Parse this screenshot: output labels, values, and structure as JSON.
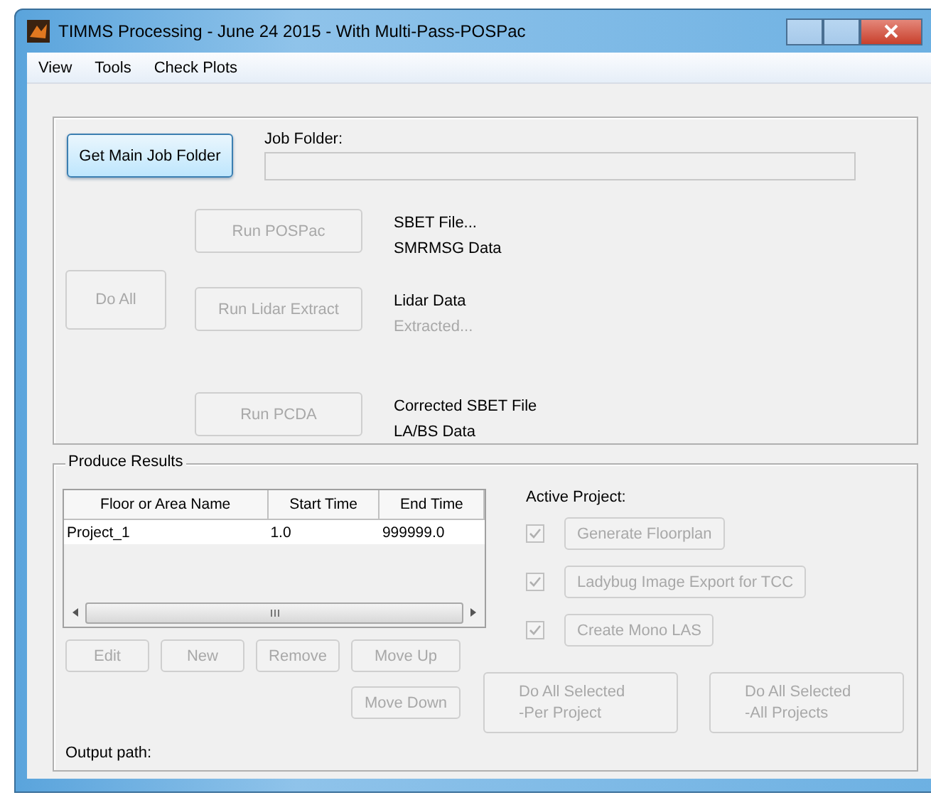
{
  "window": {
    "title": "TIMMS Processing - June 24 2015 - With Multi-Pass-POSPac"
  },
  "menu": [
    {
      "label": "View"
    },
    {
      "label": "Tools"
    },
    {
      "label": "Check Plots"
    }
  ],
  "processing": {
    "job_button": {
      "label": "Get Main Job Folder",
      "disabled": false
    },
    "job_folder_label": "Job Folder:",
    "do_all": {
      "label": "Do All",
      "disabled": true
    },
    "steps": [
      {
        "button": "Run POSPac",
        "disabled": true,
        "outputs": [
          {
            "text": "SBET File...",
            "disabled": false
          },
          {
            "text": "SMRMSG Data",
            "disabled": false
          }
        ]
      },
      {
        "button": "Run Lidar Extract",
        "disabled": true,
        "outputs": [
          {
            "text": "Lidar Data",
            "disabled": false
          },
          {
            "text": "Extracted...",
            "disabled": true
          }
        ]
      },
      {
        "button": "Run PCDA",
        "disabled": true,
        "outputs": [
          {
            "text": "Corrected SBET File",
            "disabled": false
          },
          {
            "text": "LA/BS Data",
            "disabled": false
          }
        ]
      }
    ]
  },
  "results": {
    "title": "Produce Results",
    "table": {
      "columns": [
        "Floor or Area Name",
        "Start Time",
        "End Time"
      ],
      "rows": [
        [
          "Project_1",
          "1.0",
          "999999.0"
        ]
      ]
    },
    "buttons": [
      {
        "label": "Edit",
        "disabled": true
      },
      {
        "label": "New",
        "disabled": true
      },
      {
        "label": "Remove",
        "disabled": true
      },
      {
        "label": "Move Up",
        "disabled": true
      },
      {
        "label": "Move Down",
        "disabled": true
      }
    ],
    "active_project": {
      "label": "Active Project:",
      "options": [
        {
          "label": "Generate Floorplan",
          "checked": true,
          "disabled": true
        },
        {
          "label": "Ladybug Image Export for TCC",
          "checked": true,
          "disabled": true
        },
        {
          "label": "Create Mono LAS",
          "checked": true,
          "disabled": true
        }
      ]
    },
    "run_buttons": [
      {
        "lines": [
          "Do All Selected",
          "-Per Project"
        ],
        "disabled": true
      },
      {
        "lines": [
          "Do All Selected",
          "-All Projects"
        ],
        "disabled": true
      }
    ],
    "output_path": "Output path:"
  }
}
